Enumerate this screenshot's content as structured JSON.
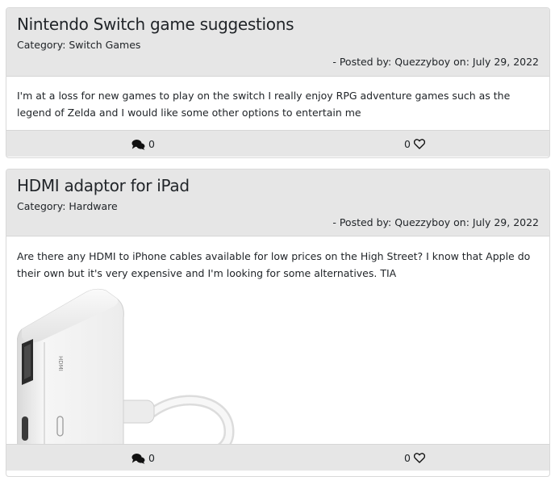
{
  "posts": [
    {
      "title": "Nintendo Switch game suggestions",
      "category": "Category: Switch Games",
      "posted": "- Posted by: Quezzyboy on: July 29, 2022",
      "body": "I'm at a loss for new games to play on the switch I really enjoy RPG adventure games such as the legend of Zelda and I would like some other options to entertain me",
      "comments": "0",
      "likes": "0",
      "has_image": false
    },
    {
      "title": "HDMI adaptor for iPad",
      "category": "Category: Hardware",
      "posted": "- Posted by: Quezzyboy on: July 29, 2022",
      "body": "Are there any HDMI to iPhone cables available for low prices on the High Street? I know that Apple do their own but it's very expensive and I'm looking for some alternatives. TIA",
      "comments": "0",
      "likes": "0",
      "has_image": true,
      "image_label": "HDMI"
    }
  ],
  "icons": {
    "comments": "comments-icon",
    "likes": "heart-outline-icon"
  },
  "colors": {
    "header_bg": "#e6e6e6",
    "footer_bg": "#e6e6e6",
    "border": "#d9d9d9",
    "text": "#212529"
  }
}
